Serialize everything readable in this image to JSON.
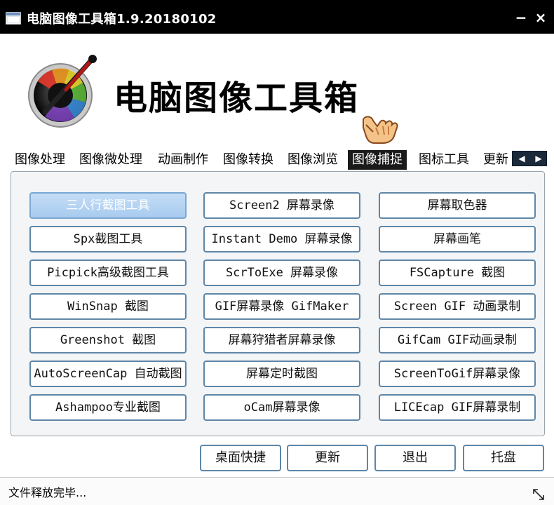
{
  "window": {
    "title": "电脑图像工具箱1.9.20180102",
    "minimize_glyph": "−",
    "close_glyph": "×"
  },
  "header": {
    "app_name": "电脑图像工具箱",
    "logo_icon": "color-picker-dial-icon",
    "hand_icon": "pointing-hand-icon"
  },
  "tabs": [
    {
      "label": "图像处理",
      "active": false
    },
    {
      "label": "图像微处理",
      "active": false
    },
    {
      "label": "动画制作",
      "active": false
    },
    {
      "label": "图像转换",
      "active": false
    },
    {
      "label": "图像浏览",
      "active": false
    },
    {
      "label": "图像捕捉",
      "active": true
    },
    {
      "label": "图标工具",
      "active": false
    },
    {
      "label": "更新",
      "active": false
    }
  ],
  "tab_scroll": {
    "left": "◀",
    "right": "▶"
  },
  "tools": [
    {
      "label": "三人行截图工具",
      "selected": true
    },
    {
      "label": "Screen2 屏幕录像"
    },
    {
      "label": "屏幕取色器"
    },
    {
      "label": "Spx截图工具"
    },
    {
      "label": "Instant Demo 屏幕录像"
    },
    {
      "label": "屏幕画笔"
    },
    {
      "label": "Picpick高级截图工具"
    },
    {
      "label": "ScrToExe 屏幕录像"
    },
    {
      "label": "FSCapture 截图"
    },
    {
      "label": "WinSnap 截图"
    },
    {
      "label": "GIF屏幕录像 GifMaker"
    },
    {
      "label": "Screen GIF 动画录制"
    },
    {
      "label": "Greenshot 截图"
    },
    {
      "label": "屏幕狩猎者屏幕录像"
    },
    {
      "label": "GifCam GIF动画录制"
    },
    {
      "label": "AutoScreenCap 自动截图"
    },
    {
      "label": "屏幕定时截图"
    },
    {
      "label": "ScreenToGif屏幕录像"
    },
    {
      "label": "Ashampoo专业截图"
    },
    {
      "label": "oCam屏幕录像"
    },
    {
      "label": "LICEcap GIF屏幕录制"
    }
  ],
  "actions": {
    "desktop_shortcut": "桌面快捷",
    "update": "更新",
    "exit": "退出",
    "tray": "托盘"
  },
  "status": {
    "text": "文件释放完毕..."
  },
  "colors": {
    "titlebar": "#000000",
    "button_border": "#5f86a8",
    "selected_button": "#a8cbef",
    "active_tab": "#1a1a1a"
  }
}
